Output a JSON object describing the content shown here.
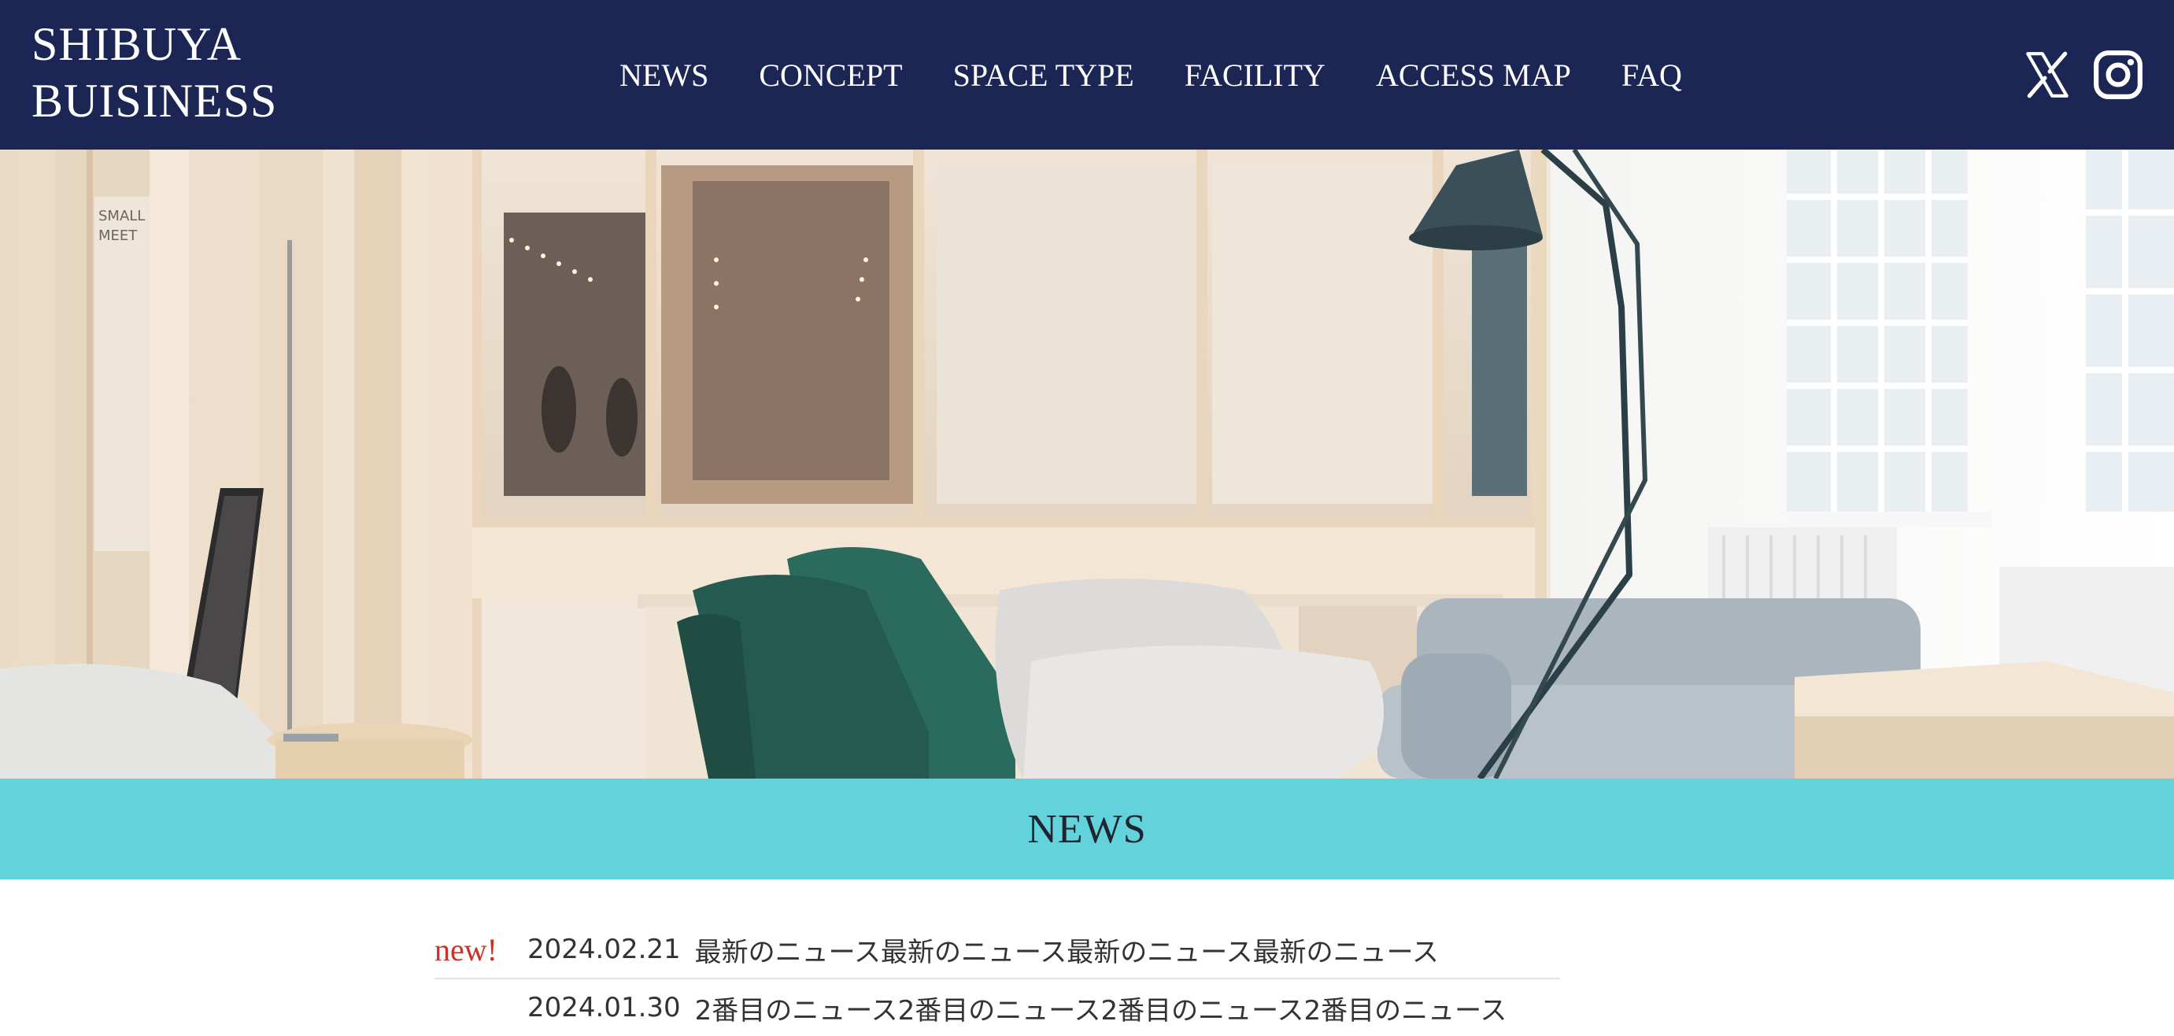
{
  "header": {
    "logo_line1": "SHIBUYA",
    "logo_line2": "BUISINESS",
    "nav": [
      "NEWS",
      "CONCEPT",
      "SPACE TYPE",
      "FACILITY",
      "ACCESS MAP",
      "FAQ"
    ],
    "social": [
      "x-icon",
      "instagram-icon"
    ]
  },
  "news": {
    "section_title": "NEWS",
    "items": [
      {
        "badge": "new!",
        "date": "2024.02.21",
        "title": "最新のニュース最新のニュース最新のニュース最新のニュース"
      },
      {
        "badge": "",
        "date": "2024.01.30",
        "title": "2番目のニュース2番目のニュース2番目のニュース2番目のニュース"
      }
    ]
  },
  "colors": {
    "header_bg": "#1b2654",
    "news_band": "#62d3db",
    "badge_red": "#c8322a"
  }
}
